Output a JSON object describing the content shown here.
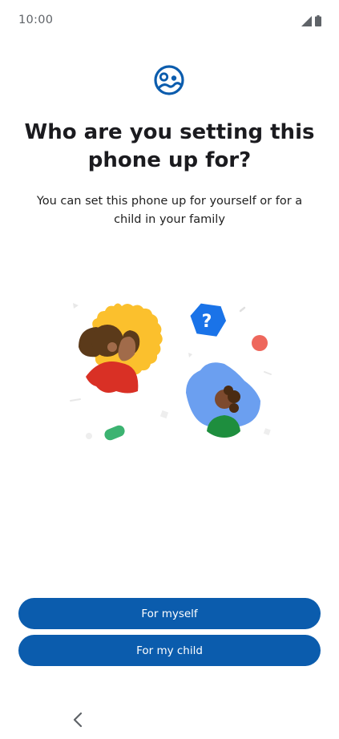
{
  "status_bar": {
    "time": "10:00",
    "icons": [
      "signal-icon",
      "battery-icon"
    ]
  },
  "header": {
    "icon": "family-link-icon",
    "title": "Who are you setting this phone up for?",
    "subtitle": "You can set this phone up for yourself or for a child in your family"
  },
  "illustration": {
    "description_icon": "parent-child-illustration",
    "badge_text": "?"
  },
  "actions": {
    "myself_label": "For myself",
    "child_label": "For my child"
  },
  "nav": {
    "back_icon": "chevron-left-icon"
  },
  "colors": {
    "primary": "#0b5cad",
    "yellow": "#fbc02d",
    "red": "#d93025",
    "blue": "#4285f4",
    "green": "#1e8e3e"
  }
}
